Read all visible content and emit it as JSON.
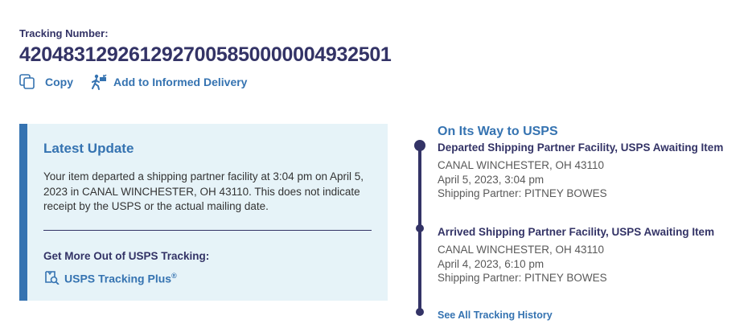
{
  "tracking": {
    "label": "Tracking Number:",
    "number": "420483129261292700585000000493250 1"
  },
  "actions": {
    "copy_label": "Copy",
    "informed_label": "Add to Informed Delivery"
  },
  "latest": {
    "heading": "Latest Update",
    "message": "Your item departed a shipping partner facility at 3:04 pm on April 5, 2023 in CANAL WINCHESTER, OH 43110. This does not indicate receipt by the USPS or the actual mailing date.",
    "more_label": "Get More Out of USPS Tracking:",
    "plus_label": "USPS Tracking Plus",
    "plus_mark": "®"
  },
  "timeline": {
    "status": "On Its Way to USPS",
    "events": [
      {
        "title": "Departed Shipping Partner Facility, USPS Awaiting Item",
        "location": "CANAL WINCHESTER, OH 43110",
        "datetime": "April 5, 2023, 3:04 pm",
        "partner": "Shipping Partner: PITNEY BOWES"
      },
      {
        "title": "Arrived Shipping Partner Facility, USPS Awaiting Item",
        "location": "CANAL WINCHESTER, OH 43110",
        "datetime": "April 4, 2023, 6:10 pm",
        "partner": "Shipping Partner: PITNEY BOWES"
      }
    ],
    "history_link": "See All Tracking History"
  },
  "colors": {
    "navy": "#333366",
    "link_blue": "#3573b1",
    "panel_bg": "#e6f3f8"
  },
  "icons": [
    "copy-icon",
    "informed-delivery-icon",
    "tracking-plus-icon"
  ]
}
